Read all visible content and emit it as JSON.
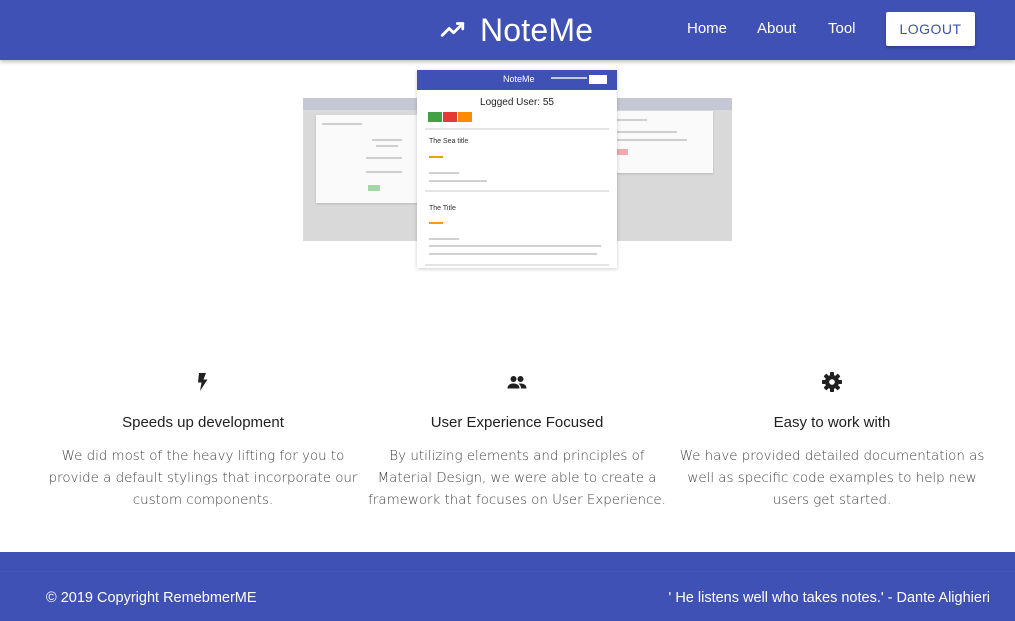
{
  "navbar": {
    "brand": "NoteMe",
    "brand_icon": "trending-up-icon",
    "links": [
      "Home",
      "About",
      "Tool"
    ],
    "logout_label": "LOGOUT",
    "color": "#3f51b5"
  },
  "hero": {
    "mini_brand": "NoteMe",
    "mini_title": "Logged User: 55",
    "mini_notes": [
      "The Sea title",
      "The Title"
    ]
  },
  "features": [
    {
      "icon": "flash-icon",
      "title": "Speeds up development",
      "description": "We did most of the heavy lifting for you to provide a default stylings that incorporate our custom components."
    },
    {
      "icon": "group-icon",
      "title": "User Experience Focused",
      "description": "By utilizing elements and principles of Material Design, we were able to create a framework that focuses on User Experience."
    },
    {
      "icon": "settings-icon",
      "title": "Easy to work with",
      "description": "We have provided detailed documentation as well as specific code examples to help new users get started."
    }
  ],
  "footer": {
    "copyright": "© 2019 Copyright RemebmerME",
    "quote": "' He listens well who takes notes.' - Dante Alighieri"
  }
}
